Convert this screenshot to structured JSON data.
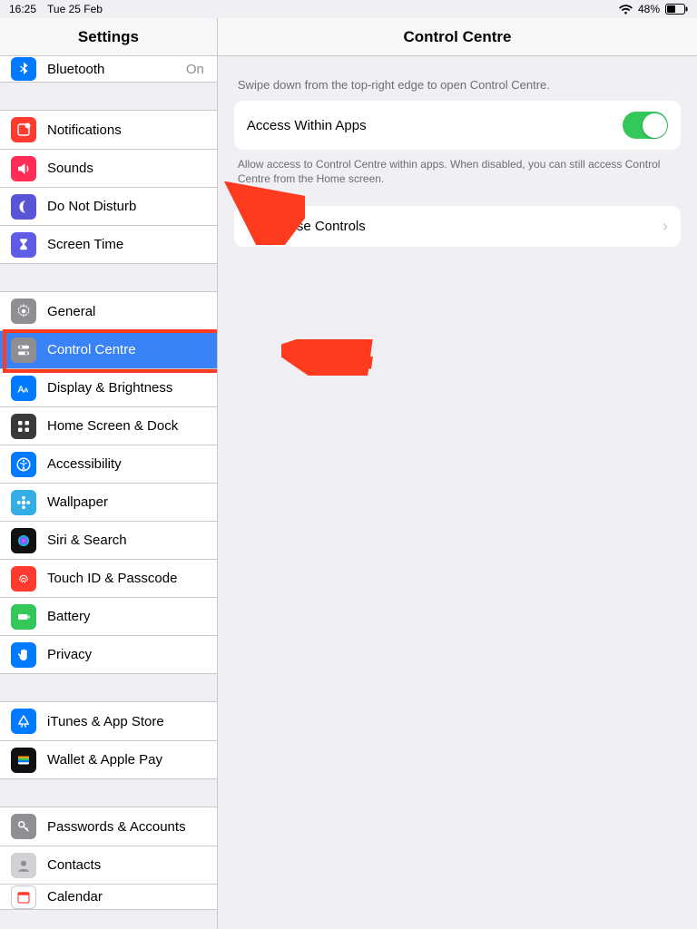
{
  "status": {
    "time": "16:25",
    "date": "Tue 25 Feb",
    "battery_pct": "48%"
  },
  "sidebar": {
    "title": "Settings",
    "groups": [
      {
        "rows": [
          {
            "icon": "bluetooth",
            "label": "Bluetooth",
            "value": "On"
          }
        ]
      },
      {
        "rows": [
          {
            "icon": "notifications",
            "label": "Notifications"
          },
          {
            "icon": "sounds",
            "label": "Sounds"
          },
          {
            "icon": "dnd",
            "label": "Do Not Disturb"
          },
          {
            "icon": "screentime",
            "label": "Screen Time"
          }
        ]
      },
      {
        "rows": [
          {
            "icon": "general",
            "label": "General"
          },
          {
            "icon": "controlcentre",
            "label": "Control Centre",
            "selected": true
          },
          {
            "icon": "display",
            "label": "Display & Brightness"
          },
          {
            "icon": "homescreen",
            "label": "Home Screen & Dock"
          },
          {
            "icon": "accessibility",
            "label": "Accessibility"
          },
          {
            "icon": "wallpaper",
            "label": "Wallpaper"
          },
          {
            "icon": "siri",
            "label": "Siri & Search"
          },
          {
            "icon": "touchid",
            "label": "Touch ID & Passcode"
          },
          {
            "icon": "battery",
            "label": "Battery"
          },
          {
            "icon": "privacy",
            "label": "Privacy"
          }
        ]
      },
      {
        "rows": [
          {
            "icon": "appstore",
            "label": "iTunes & App Store"
          },
          {
            "icon": "wallet",
            "label": "Wallet & Apple Pay"
          }
        ]
      },
      {
        "rows": [
          {
            "icon": "passwords",
            "label": "Passwords & Accounts"
          },
          {
            "icon": "contacts",
            "label": "Contacts"
          },
          {
            "icon": "calendar",
            "label": "Calendar"
          }
        ]
      }
    ]
  },
  "detail": {
    "title": "Control Centre",
    "intro": "Swipe down from the top-right edge to open Control Centre.",
    "access_label": "Access Within Apps",
    "access_on": true,
    "access_footer": "Allow access to Control Centre within apps. When disabled, you can still access Control Centre from the Home screen.",
    "customise_label": "Customise Controls"
  }
}
